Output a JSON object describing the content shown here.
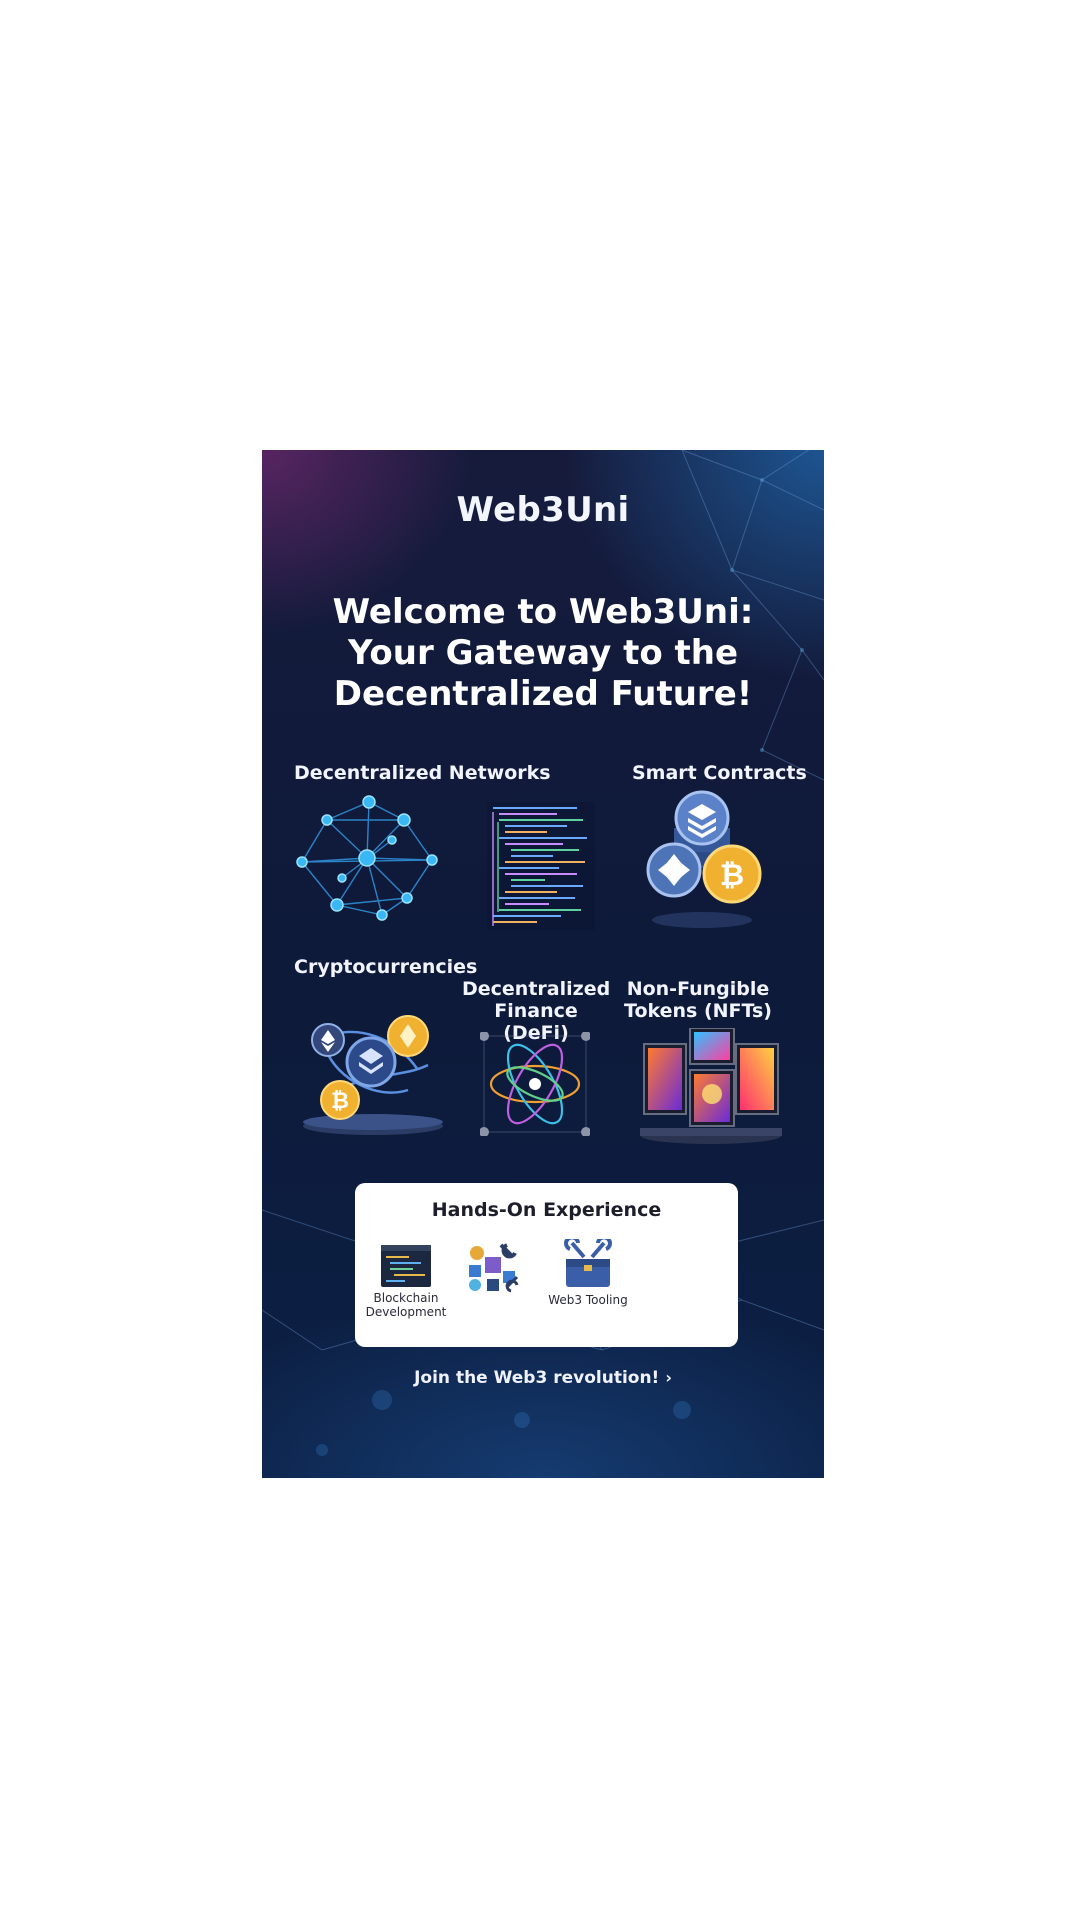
{
  "app": {
    "brand": "Web3Uni"
  },
  "hero": {
    "line1": "Welcome to Web3Uni:",
    "line2": "Your Gateway to the",
    "line3": "Decentralized Future!"
  },
  "features": {
    "networks": "Decentralized Networks",
    "contracts": "Smart Contracts",
    "crypto": "Cryptocurrencies",
    "defi_line1": "Decentralized",
    "defi_line2": "Finance (DeFi)",
    "nft_line1": "Non-Fungible",
    "nft_line2": "Tokens (NFTs)"
  },
  "hands_on": {
    "title": "Hands-On Experience",
    "items": [
      {
        "line1": "Blockchain",
        "line2": "Development",
        "icon": "code-window-icon"
      },
      {
        "line1": "",
        "line2": "",
        "icon": "puzzle-tools-icon"
      },
      {
        "line1": "Web3 Tooling",
        "line2": "",
        "icon": "toolbox-icon"
      }
    ]
  },
  "cta": {
    "label": "Join the Web3 revolution!",
    "icon": "chevron-right-icon"
  },
  "colors": {
    "gold": "#f0b030",
    "node": "#35b6f0",
    "steel": "#4a6fb0"
  }
}
